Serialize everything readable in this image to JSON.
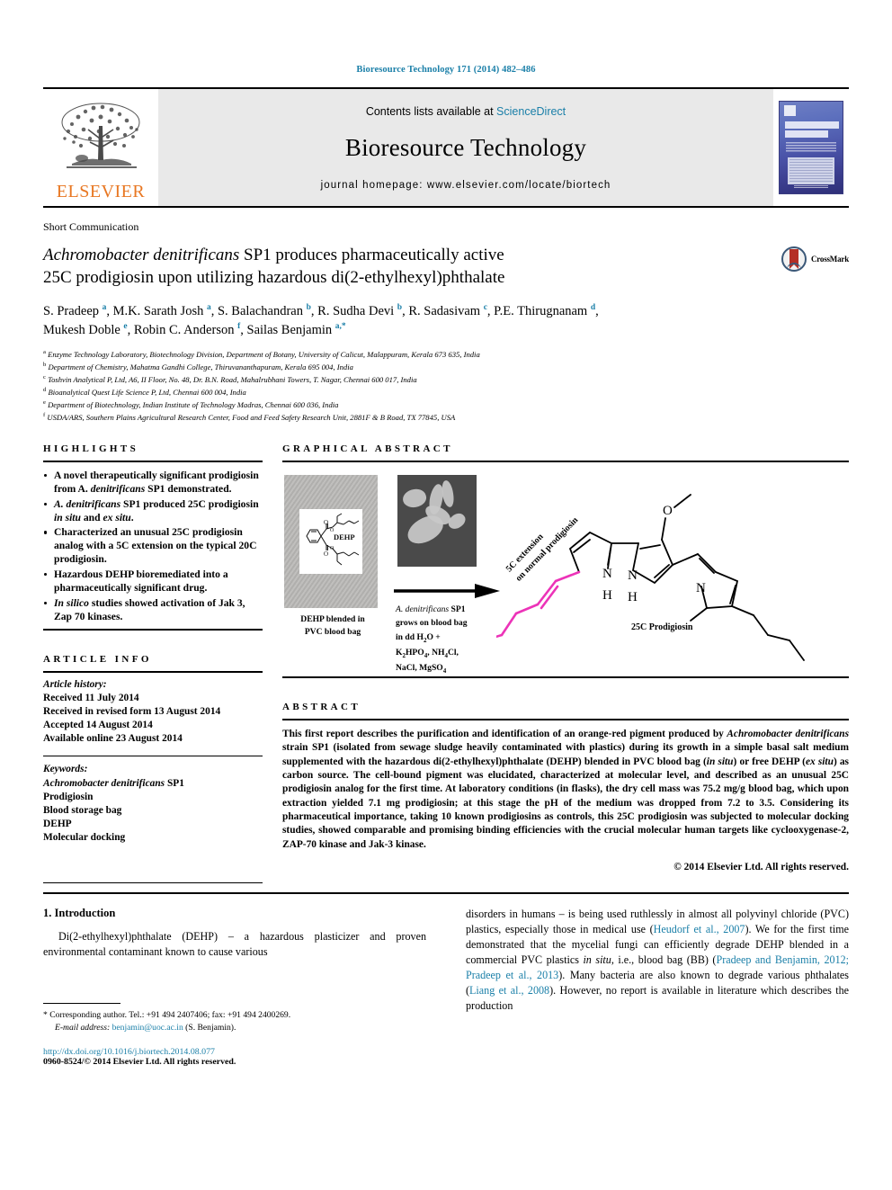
{
  "running_head": "Bioresource Technology 171 (2014) 482–486",
  "masthead": {
    "contents_prefix": "Contents lists available at ",
    "sciencedirect": "ScienceDirect",
    "journal_title": "Bioresource Technology",
    "homepage": "journal homepage: www.elsevier.com/locate/biortech",
    "publisher": "ELSEVIER",
    "cover_line1": "BIORESOURCE",
    "cover_line2": "TECHNOLOGY"
  },
  "article": {
    "type_label": "Short Communication",
    "title_line1_italic": "Achromobacter denitrificans",
    "title_line1_rest": " SP1 produces pharmaceutically active",
    "title_line2": "25C prodigiosin upon utilizing hazardous di(2-ethylhexyl)phthalate",
    "crossmark_label": "CrossMark",
    "authors_line1": "S. Pradeep a, M.K. Sarath Josh a, S. Balachandran b, R. Sudha Devi b, R. Sadasivam c, P.E. Thirugnanam d,",
    "authors_line2": "Mukesh Doble e, Robin C. Anderson f, Sailas Benjamin a,*",
    "affiliations": [
      {
        "mark": "a",
        "text": "Enzyme Technology Laboratory, Biotechnology Division, Department of Botany, University of Calicut, Malappuram, Kerala 673 635, India"
      },
      {
        "mark": "b",
        "text": "Department of Chemistry, Mahatma Gandhi College, Thiruvananthapuram, Kerala 695 004, India"
      },
      {
        "mark": "c",
        "text": "Toshvin Analytical P, Ltd, A6, II Floor, No. 48, Dr. B.N. Road, Mahalrubhani Towers, T. Nagar, Chennai 600 017, India"
      },
      {
        "mark": "d",
        "text": "Bioanalytical Quest Life Science P, Ltd, Chennai 600 004, India"
      },
      {
        "mark": "e",
        "text": "Department of Biotechnology, Indian Institute of Technology Madras, Chennai 600 036, India"
      },
      {
        "mark": "f",
        "text": "USDA/ARS, Southern Plains Agricultural Research Center, Food and Feed Safety Research Unit, 2881F & B Road, TX 77845, USA"
      }
    ]
  },
  "highlights": {
    "heading": "HIGHLIGHTS",
    "items": [
      "A novel therapeutically significant prodigiosin from A. denitrificans SP1 demonstrated.",
      "A. denitrificans SP1 produced 25C prodigiosin in situ and ex situ.",
      "Characterized an unusual 25C prodigiosin analog with a 5C extension on the typical 20C prodigiosin.",
      "Hazardous DEHP bioremediated into a pharmaceutically significant drug.",
      "In silico studies showed activation of Jak 3, Zap 70 kinases."
    ]
  },
  "article_info": {
    "heading": "ARTICLE INFO",
    "history_label": "Article history:",
    "history": [
      "Received 11 July 2014",
      "Received in revised form 13 August 2014",
      "Accepted 14 August 2014",
      "Available online 23 August 2014"
    ],
    "keywords_label": "Keywords:",
    "keywords": [
      "Achromobacter denitrificans SP1",
      "Prodigiosin",
      "Blood storage bag",
      "DEHP",
      "Molecular docking"
    ]
  },
  "graphical_abstract": {
    "heading": "GRAPHICAL ABSTRACT",
    "panel1_caption_line1": "DEHP blended in",
    "panel1_caption_line2": "PVC blood bag",
    "dehp_label": "DEHP",
    "reaction_line1_italic": "A. denitrificans",
    "reaction_line1_rest": " SP1",
    "reaction_line2": "grows on blood bag",
    "reaction_line3": "in dd H2O +",
    "reaction_line4": "K2HPO4, NH4Cl,",
    "reaction_line5": "NaCl, MgSO4",
    "product_label": "25C Prodigiosin",
    "extension_label_line1": "5C extension",
    "extension_label_line2": "on normal prodigiosin",
    "pyrrole_n": "N",
    "pyrrole_h": "H",
    "methoxy_o": "O",
    "accent_color": "#ec33b8"
  },
  "abstract": {
    "heading": "ABSTRACT",
    "body": "This first report describes the purification and identification of an orange-red pigment produced by Achromobacter denitrificans strain SP1 (isolated from sewage sludge heavily contaminated with plastics) during its growth in a simple basal salt medium supplemented with the hazardous di(2-ethylhexyl)phthalate (DEHP) blended in PVC blood bag (in situ) or free DEHP (ex situ) as carbon source. The cell-bound pigment was elucidated, characterized at molecular level, and described as an unusual 25C prodigiosin analog for the first time. At laboratory conditions (in flasks), the dry cell mass was 75.2 mg/g blood bag, which upon extraction yielded 7.1 mg prodigiosin; at this stage the pH of the medium was dropped from 7.2 to 3.5. Considering its pharmaceutical importance, taking 10 known prodigiosins as controls, this 25C prodigiosin was subjected to molecular docking studies, showed comparable and promising binding efficiencies with the crucial molecular human targets like cyclooxygenase-2, ZAP-70 kinase and Jak-3 kinase.",
    "copyright": "© 2014 Elsevier Ltd. All rights reserved."
  },
  "body": {
    "section_heading": "1. Introduction",
    "left_paragraph": "Di(2-ethylhexyl)phthalate (DEHP) – a hazardous plasticizer and proven environmental contaminant known to cause various",
    "right_paragraph": "disorders in humans – is being used ruthlessly in almost all polyvinyl chloride (PVC) plastics, especially those in medical use (Heudorf et al., 2007). We for the first time demonstrated that the mycelial fungi can efficiently degrade DEHP blended in a commercial PVC plastics in situ, i.e., blood bag (BB) (Pradeep and Benjamin, 2012; Pradeep et al., 2013). Many bacteria are also known to degrade various phthalates (Liang et al., 2008). However, no report is available in literature which describes the production"
  },
  "footer": {
    "corresponding_marker": "*",
    "corresponding": "Corresponding author. Tel.: +91 494 2407406; fax: +91 494 2400269.",
    "email_label": "E-mail address:",
    "email": "benjamin@uoc.ac.in",
    "email_suffix": " (S. Benjamin).",
    "doi": "http://dx.doi.org/10.1016/j.biortech.2014.08.077",
    "issn": "0960-8524/© 2014 Elsevier Ltd. All rights reserved."
  },
  "colors": {
    "link": "#1a7fa8",
    "elsevier_orange": "#e87722",
    "accent_pink": "#ec33b8"
  }
}
